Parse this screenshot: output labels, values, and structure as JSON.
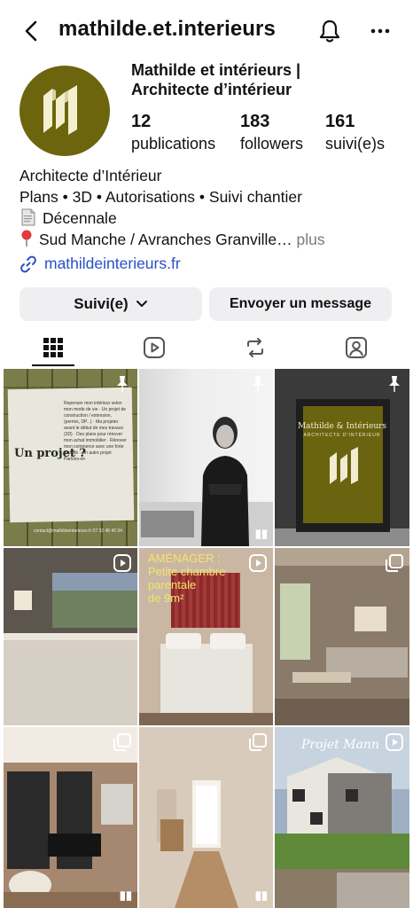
{
  "header": {
    "username": "mathilde.et.interieurs",
    "back_icon": "chevron-left-icon",
    "bell_icon": "bell-icon",
    "more_icon": "more-horizontal-icon"
  },
  "profile": {
    "display_name_line1": "Mathilde et intérieurs |",
    "display_name_line2": "Architecte d’intérieur",
    "avatar_color": "#6c650d",
    "stats": [
      {
        "value": "12",
        "label": "publications"
      },
      {
        "value": "183",
        "label": "followers"
      },
      {
        "value": "161",
        "label": "suivi(e)s"
      }
    ],
    "bio": {
      "line1": "Architecte d’Intérieur",
      "line2": "Plans • 3D • Autorisations • Suivi chantier",
      "line3": "Décennale",
      "line4": "Sud Manche / Avranches Granville…",
      "more": " plus"
    },
    "website": "mathildeinterieurs.fr"
  },
  "actions": {
    "follow_label": "Suivi(e)",
    "message_label": "Envoyer un message"
  },
  "tabs": [
    "grid-icon",
    "reels-icon",
    "reposts-icon",
    "tagged-icon"
  ],
  "posts": {
    "p1": {
      "heading": "Un projet ?",
      "lines": "Repenser mon intérieur selon mon mode de vie · Un projet de construction / extension, (permis, DP...) · Ma projeter avant le début de mes travaux (3D) · Des plans pour rénover mon achat immobilier · Rénover mon commerce avec une forte identité · Un autre projet Parlons-en",
      "footer": "contact@mathildeinterieurs.fr  07 32 48 40 34"
    },
    "p3": {
      "title": "Mathilde & Intérieurs",
      "subtitle": "ARCHITECTE D’INTÉRIEUR"
    },
    "p5": {
      "line1": "AMÉNAGER :",
      "line2": "Petite chambre",
      "line3": "parentale",
      "line4": "de 9m²"
    },
    "p9": {
      "label": "Projet Mann"
    }
  },
  "colors": {
    "link": "#2b4fc8",
    "button_bg": "#efeff1",
    "brand_olive": "#6c650d"
  }
}
